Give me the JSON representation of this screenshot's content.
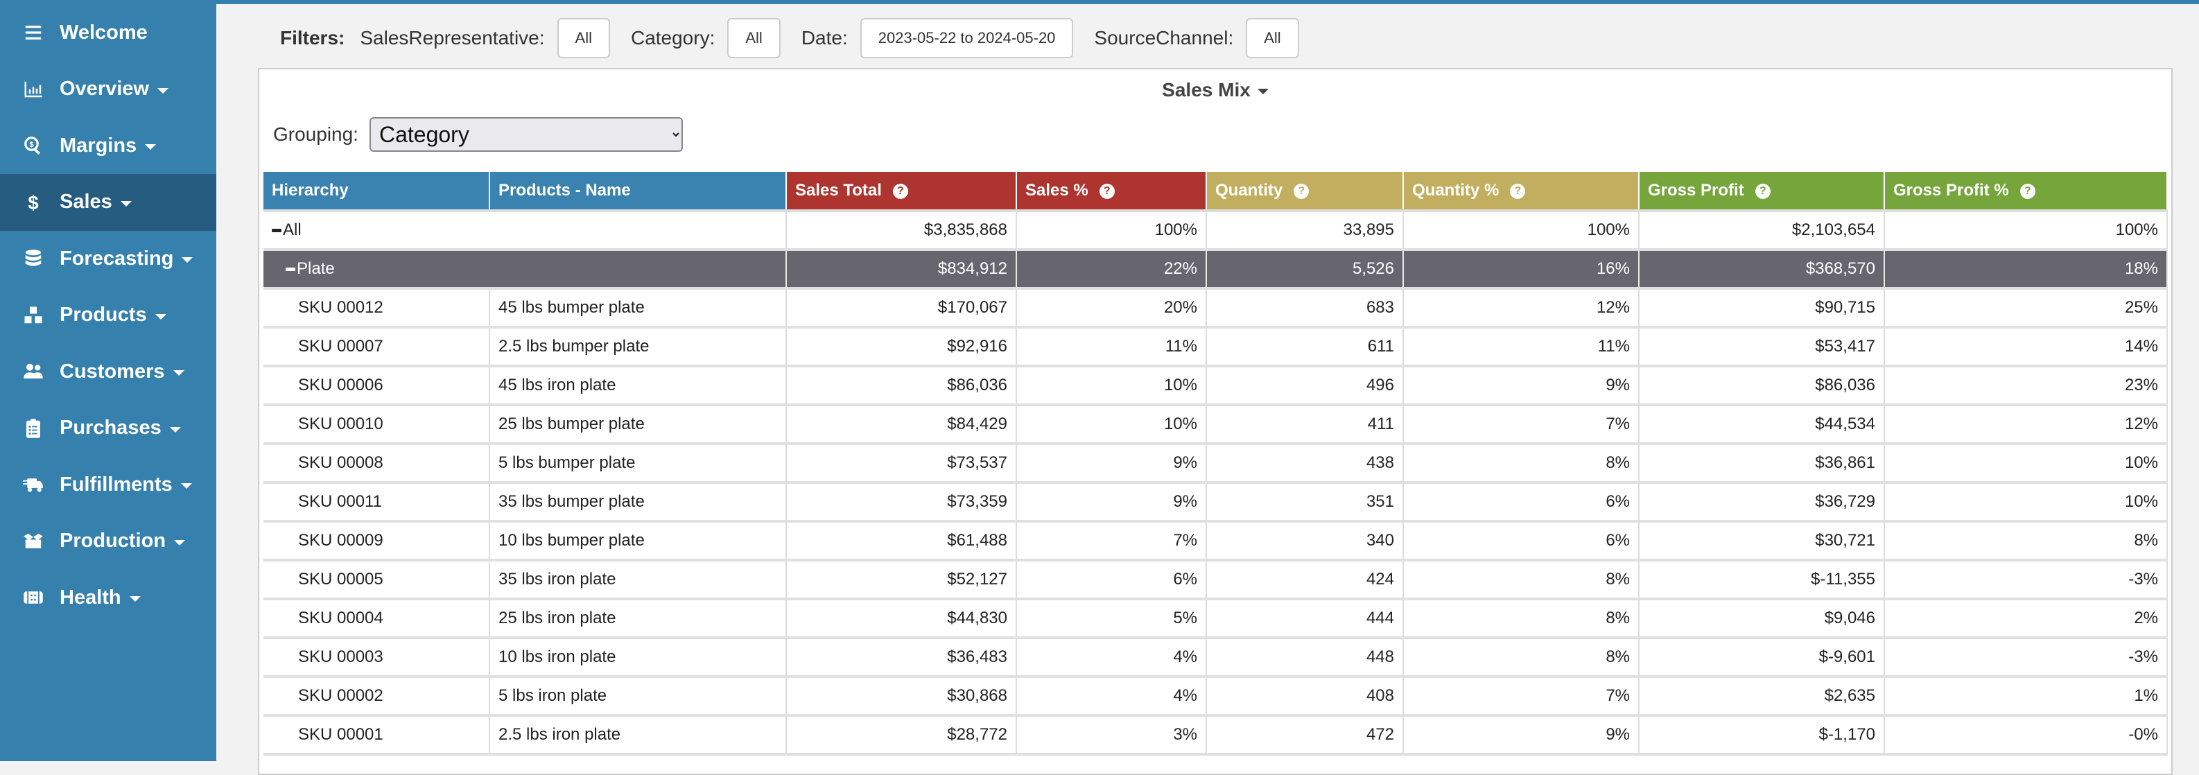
{
  "sidebar": {
    "items": [
      {
        "label": "Welcome",
        "icon": "menu-icon",
        "caret": false,
        "active": false
      },
      {
        "label": "Overview",
        "icon": "chart-bar-icon",
        "caret": true,
        "active": false
      },
      {
        "label": "Margins",
        "icon": "search-dollar-icon",
        "caret": true,
        "active": false
      },
      {
        "label": "Sales",
        "icon": "dollar-icon",
        "caret": true,
        "active": true
      },
      {
        "label": "Forecasting",
        "icon": "database-icon",
        "caret": true,
        "active": false
      },
      {
        "label": "Products",
        "icon": "boxes-icon",
        "caret": true,
        "active": false
      },
      {
        "label": "Customers",
        "icon": "users-icon",
        "caret": true,
        "active": false
      },
      {
        "label": "Purchases",
        "icon": "clipboard-list-icon",
        "caret": true,
        "active": false
      },
      {
        "label": "Fulfillments",
        "icon": "shipping-fast-icon",
        "caret": true,
        "active": false
      },
      {
        "label": "Production",
        "icon": "box-open-icon",
        "caret": true,
        "active": false
      },
      {
        "label": "Health",
        "icon": "first-aid-icon",
        "caret": true,
        "active": false
      }
    ]
  },
  "filters": {
    "title": "Filters:",
    "sales_rep_label": "SalesRepresentative:",
    "sales_rep_value": "All",
    "category_label": "Category:",
    "category_value": "All",
    "date_label": "Date:",
    "date_value": "2023-05-22 to 2024-05-20",
    "source_label": "SourceChannel:",
    "source_value": "All"
  },
  "panel": {
    "title": "Sales Mix",
    "grouping_label": "Grouping:",
    "grouping_value": "Category"
  },
  "colors": {
    "sidebar": "#3580ad",
    "sidebar_active": "#255c80",
    "header_blue": "#3a82b0",
    "header_red": "#ae3430",
    "header_gold": "#c2ae5f",
    "header_green": "#75a53b",
    "group_row": "#67666f"
  },
  "table": {
    "columns": [
      {
        "label": "Hierarchy",
        "color": "blue",
        "help": false
      },
      {
        "label": "Products - Name",
        "color": "blue",
        "help": false
      },
      {
        "label": "Sales Total",
        "color": "red",
        "help": true
      },
      {
        "label": "Sales %",
        "color": "red",
        "help": true
      },
      {
        "label": "Quantity",
        "color": "gold",
        "help": true
      },
      {
        "label": "Quantity %",
        "color": "gold",
        "help": true
      },
      {
        "label": "Gross Profit",
        "color": "green",
        "help": true
      },
      {
        "label": "Gross Profit %",
        "color": "green",
        "help": true
      }
    ],
    "rows": [
      {
        "type": "total",
        "hierarchy": "All",
        "name": "",
        "sales_total": "$3,835,868",
        "sales_pct": "100%",
        "quantity": "33,895",
        "quantity_pct": "100%",
        "gross_profit": "$2,103,654",
        "gross_profit_pct": "100%"
      },
      {
        "type": "group",
        "hierarchy": "Plate",
        "name": "",
        "sales_total": "$834,912",
        "sales_pct": "22%",
        "quantity": "5,526",
        "quantity_pct": "16%",
        "gross_profit": "$368,570",
        "gross_profit_pct": "18%"
      },
      {
        "type": "item",
        "hierarchy": "SKU 00012",
        "name": "45 lbs bumper plate",
        "sales_total": "$170,067",
        "sales_pct": "20%",
        "quantity": "683",
        "quantity_pct": "12%",
        "gross_profit": "$90,715",
        "gross_profit_pct": "25%"
      },
      {
        "type": "item",
        "hierarchy": "SKU 00007",
        "name": "2.5 lbs bumper plate",
        "sales_total": "$92,916",
        "sales_pct": "11%",
        "quantity": "611",
        "quantity_pct": "11%",
        "gross_profit": "$53,417",
        "gross_profit_pct": "14%"
      },
      {
        "type": "item",
        "hierarchy": "SKU 00006",
        "name": "45 lbs iron plate",
        "sales_total": "$86,036",
        "sales_pct": "10%",
        "quantity": "496",
        "quantity_pct": "9%",
        "gross_profit": "$86,036",
        "gross_profit_pct": "23%"
      },
      {
        "type": "item",
        "hierarchy": "SKU 00010",
        "name": "25 lbs bumper plate",
        "sales_total": "$84,429",
        "sales_pct": "10%",
        "quantity": "411",
        "quantity_pct": "7%",
        "gross_profit": "$44,534",
        "gross_profit_pct": "12%"
      },
      {
        "type": "item",
        "hierarchy": "SKU 00008",
        "name": "5 lbs bumper plate",
        "sales_total": "$73,537",
        "sales_pct": "9%",
        "quantity": "438",
        "quantity_pct": "8%",
        "gross_profit": "$36,861",
        "gross_profit_pct": "10%"
      },
      {
        "type": "item",
        "hierarchy": "SKU 00011",
        "name": "35 lbs bumper plate",
        "sales_total": "$73,359",
        "sales_pct": "9%",
        "quantity": "351",
        "quantity_pct": "6%",
        "gross_profit": "$36,729",
        "gross_profit_pct": "10%"
      },
      {
        "type": "item",
        "hierarchy": "SKU 00009",
        "name": "10 lbs bumper plate",
        "sales_total": "$61,488",
        "sales_pct": "7%",
        "quantity": "340",
        "quantity_pct": "6%",
        "gross_profit": "$30,721",
        "gross_profit_pct": "8%"
      },
      {
        "type": "item",
        "hierarchy": "SKU 00005",
        "name": "35 lbs iron plate",
        "sales_total": "$52,127",
        "sales_pct": "6%",
        "quantity": "424",
        "quantity_pct": "8%",
        "gross_profit": "$-11,355",
        "gross_profit_pct": "-3%"
      },
      {
        "type": "item",
        "hierarchy": "SKU 00004",
        "name": "25 lbs iron plate",
        "sales_total": "$44,830",
        "sales_pct": "5%",
        "quantity": "444",
        "quantity_pct": "8%",
        "gross_profit": "$9,046",
        "gross_profit_pct": "2%"
      },
      {
        "type": "item",
        "hierarchy": "SKU 00003",
        "name": "10 lbs iron plate",
        "sales_total": "$36,483",
        "sales_pct": "4%",
        "quantity": "448",
        "quantity_pct": "8%",
        "gross_profit": "$-9,601",
        "gross_profit_pct": "-3%"
      },
      {
        "type": "item",
        "hierarchy": "SKU 00002",
        "name": "5 lbs iron plate",
        "sales_total": "$30,868",
        "sales_pct": "4%",
        "quantity": "408",
        "quantity_pct": "7%",
        "gross_profit": "$2,635",
        "gross_profit_pct": "1%"
      },
      {
        "type": "item",
        "hierarchy": "SKU 00001",
        "name": "2.5 lbs iron plate",
        "sales_total": "$28,772",
        "sales_pct": "3%",
        "quantity": "472",
        "quantity_pct": "9%",
        "gross_profit": "$-1,170",
        "gross_profit_pct": "-0%"
      }
    ]
  }
}
